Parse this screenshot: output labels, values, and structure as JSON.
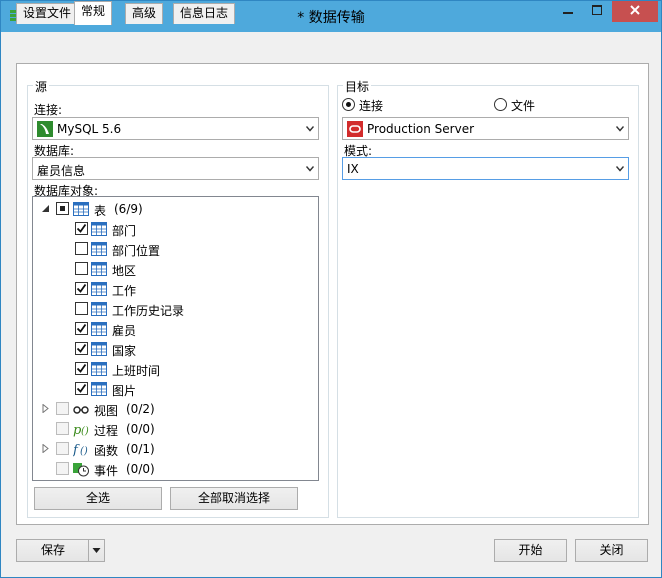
{
  "window": {
    "title": "* 数据传输"
  },
  "tabs": [
    {
      "label": "设置文件"
    },
    {
      "label": "常规"
    },
    {
      "label": "高级"
    },
    {
      "label": "信息日志"
    }
  ],
  "source": {
    "group_label": "源",
    "connection_label": "连接:",
    "connection_value": "MySQL 5.6",
    "database_label": "数据库:",
    "database_value": "雇员信息",
    "objects_label": "数据库对象:",
    "tree": {
      "tables": {
        "label": "表",
        "count": "(6/9)"
      },
      "table_items": [
        {
          "label": "部门",
          "checked": true
        },
        {
          "label": "部门位置",
          "checked": false
        },
        {
          "label": "地区",
          "checked": false
        },
        {
          "label": "工作",
          "checked": true
        },
        {
          "label": "工作历史记录",
          "checked": false
        },
        {
          "label": "雇员",
          "checked": true
        },
        {
          "label": "国家",
          "checked": true
        },
        {
          "label": "上班时间",
          "checked": true
        },
        {
          "label": "图片",
          "checked": true
        }
      ],
      "views": {
        "label": "视图",
        "count": "(0/2)"
      },
      "procedures": {
        "label": "过程",
        "count": "(0/0)"
      },
      "functions": {
        "label": "函数",
        "count": "(0/1)"
      },
      "events": {
        "label": "事件",
        "count": "(0/0)"
      }
    },
    "select_all": "全选",
    "deselect_all": "全部取消选择"
  },
  "target": {
    "group_label": "目标",
    "radio_connection": "连接",
    "radio_file": "文件",
    "connection_value": "Production Server",
    "schema_label": "模式:",
    "schema_value": "IX"
  },
  "footer": {
    "save": "保存",
    "start": "开始",
    "close": "关闭"
  },
  "colors": {
    "titlebar": "#4ea9dc",
    "close_button": "#c75050",
    "mysql_icon": "#2e8b2e",
    "oracle_icon": "#d22b2b"
  }
}
